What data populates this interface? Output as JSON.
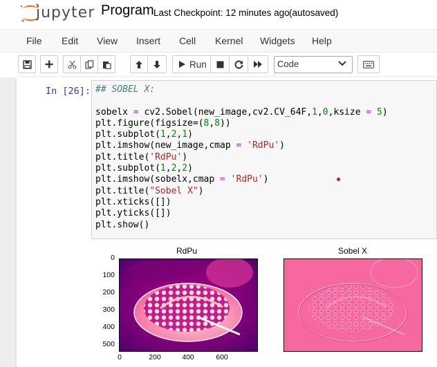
{
  "header": {
    "logo_text": "jupyter",
    "notebook_name": "Program",
    "checkpoint": "Last Checkpoint: 12 minutes ago",
    "autosave_status": "(autosaved)",
    "logo_color": "#f37726"
  },
  "menu": [
    "File",
    "Edit",
    "View",
    "Insert",
    "Cell",
    "Kernel",
    "Widgets",
    "Help"
  ],
  "toolbar": {
    "run_label": "Run",
    "cell_type": "Code",
    "icons": [
      "save-icon",
      "add-cell-icon",
      "cut-icon",
      "copy-icon",
      "paste-icon",
      "move-up-icon",
      "move-down-icon",
      "run-icon",
      "stop-icon",
      "restart-icon",
      "fast-forward-icon",
      "keyboard-icon"
    ]
  },
  "cell": {
    "prompt": "In [26]:",
    "code_lines": [
      "## SOBEL X:",
      "",
      "sobelx = cv2.Sobel(new_image,cv2.CV_64F,1,0,ksize = 5)",
      "plt.figure(figsize=(8,8))",
      "plt.subplot(1,2,1)",
      "plt.imshow(new_image,cmap = 'RdPu')",
      "plt.title('RdPu')",
      "plt.subplot(1,2,2)",
      "plt.imshow(sobelx,cmap = 'RdPu')",
      "plt.title(\"Sobel X\")",
      "plt.xticks([])",
      "plt.yticks([])",
      "plt.show()"
    ]
  },
  "output": {
    "left_plot": {
      "title": "RdPu",
      "y_ticks": [
        "0",
        "100",
        "200",
        "300",
        "400",
        "500"
      ],
      "x_ticks": [
        "0",
        "200",
        "400",
        "600"
      ]
    },
    "right_plot": {
      "title": "Sobel X"
    },
    "colormap_colors": [
      "#fff7f3",
      "#fcc5c0",
      "#f768a1",
      "#ae017e",
      "#49006a"
    ]
  }
}
